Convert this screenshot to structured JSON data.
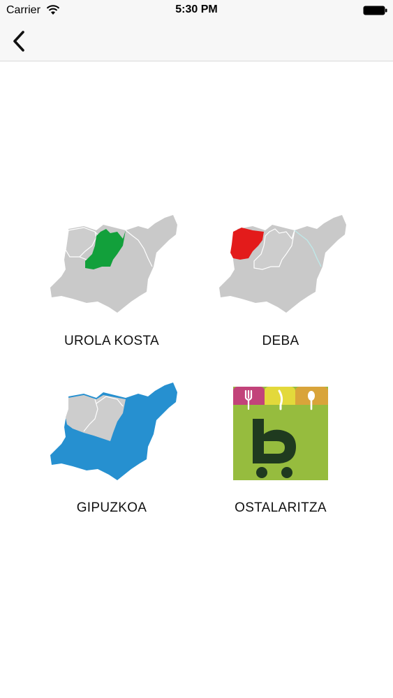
{
  "status_bar": {
    "carrier": "Carrier",
    "time": "5:30 PM",
    "wifi_icon": "wifi-icon",
    "battery_icon": "battery-full-icon"
  },
  "nav": {
    "back_icon": "chevron-left-icon"
  },
  "tiles": [
    {
      "label": "UROLA KOSTA",
      "highlight_color": "#12a03b",
      "base_color": "#c9c9c9"
    },
    {
      "label": "DEBA",
      "highlight_color": "#e31b1b",
      "base_color": "#c9c9c9"
    },
    {
      "label": "GIPUZKOA",
      "highlight_color": "#2690d0",
      "base_color": "#c9c9c9"
    },
    {
      "label": "OSTALARITZA",
      "logo_colors": [
        "#c2437a",
        "#e3d93b",
        "#d9a43a",
        "#96bc3e",
        "#1f3a1f"
      ]
    }
  ]
}
